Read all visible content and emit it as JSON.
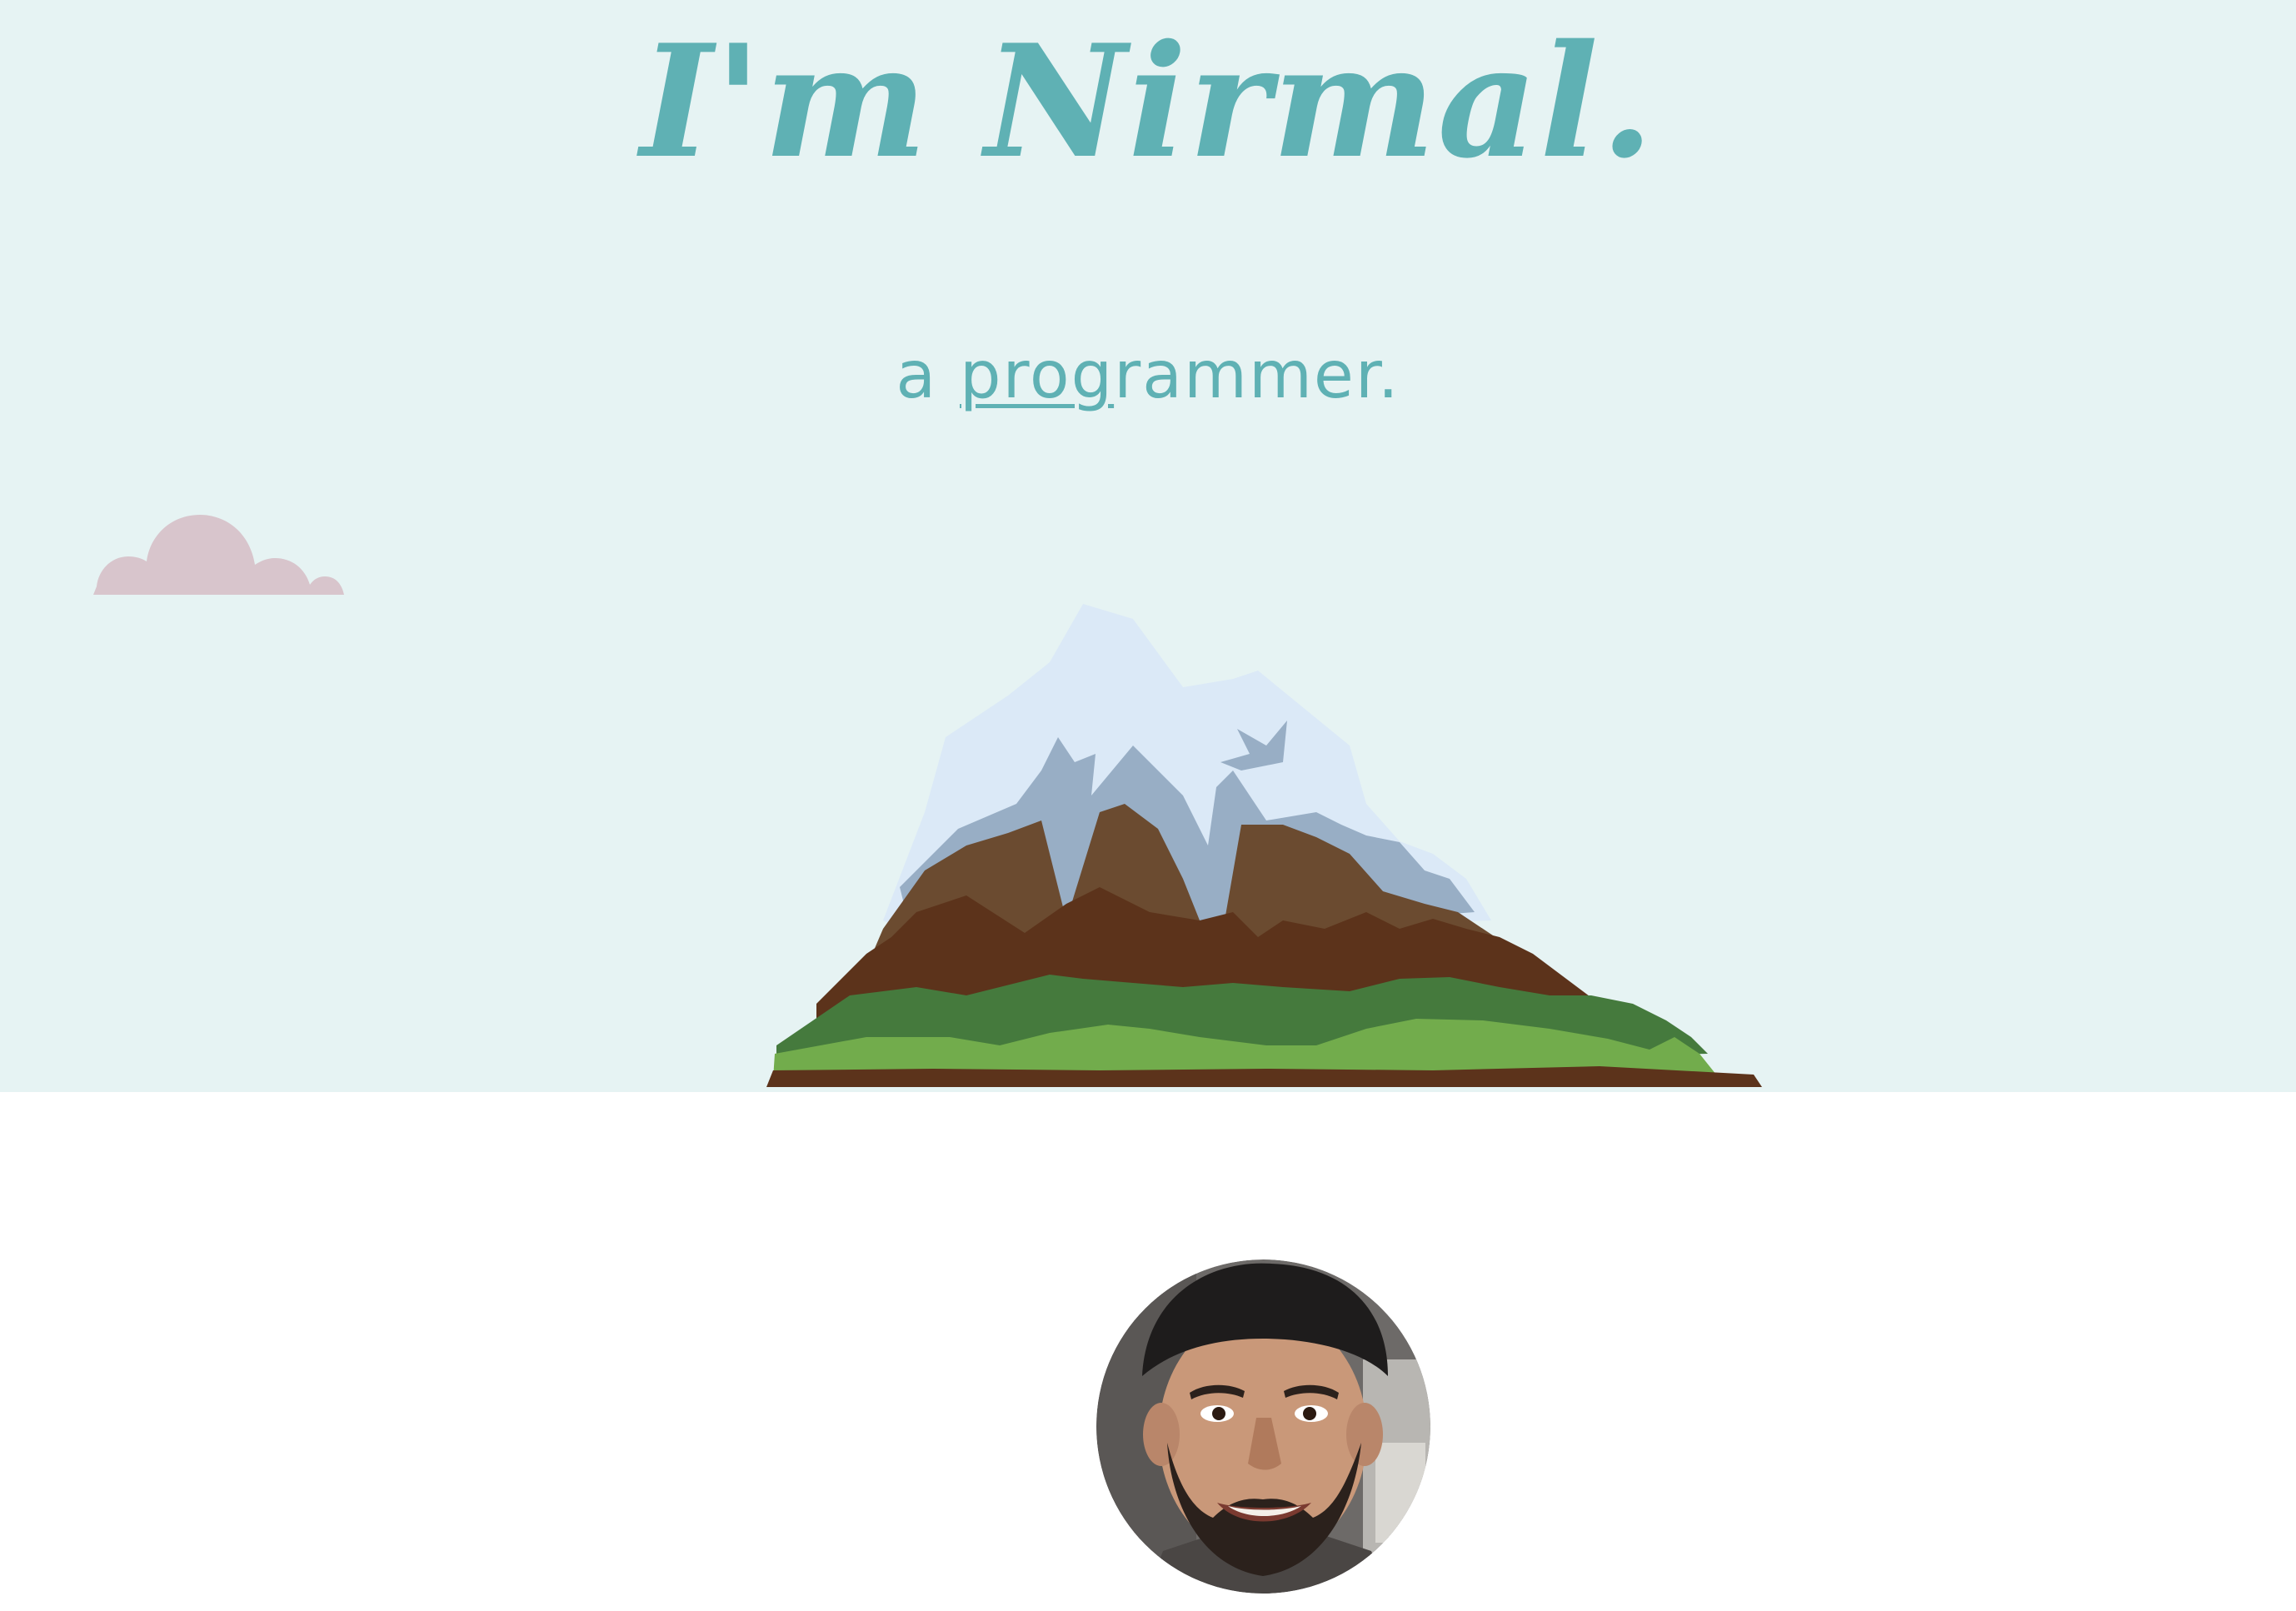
{
  "hero": {
    "title": "I'm Nirmal.",
    "subtitle_prefix": "a",
    "subtitle_typed_underlined": "prog",
    "subtitle_typed_rest": "rammer."
  },
  "colors": {
    "hero_background": "#e6f3f3",
    "accent_teal": "#5fb1b4",
    "cloud": "#d8c5cc",
    "page_background": "#ffffff"
  },
  "icons": {
    "cloud": "cloud-icon",
    "mountain": "mountain-illustration",
    "avatar": "profile-photo"
  }
}
